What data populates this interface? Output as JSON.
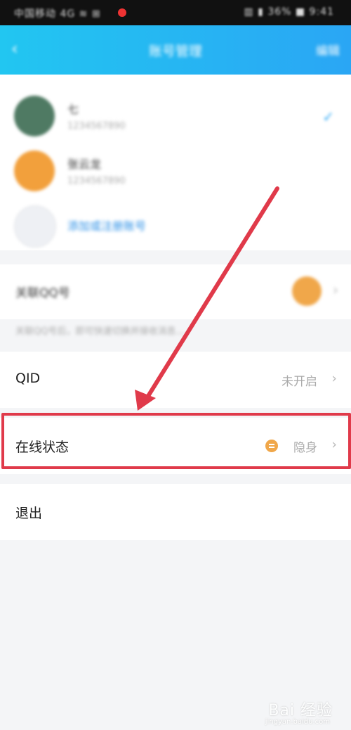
{
  "status_bar": {
    "left_text": "中国移动 4G ≋ ⊞",
    "right_text": "▥ ▮ 36% ■ 9:41"
  },
  "header": {
    "back_icon": "back-arrow-icon",
    "title": "账号管理",
    "action": "编辑"
  },
  "accounts": {
    "items": [
      {
        "name": "七",
        "sub": "1234567890",
        "avatar_color": "#4f7a63",
        "selected": true
      },
      {
        "name": "张云龙",
        "sub": "1234567890",
        "avatar_color": "#f2a03c",
        "selected": false
      }
    ],
    "add_label": "添加或注册账号",
    "checkmark": "✓"
  },
  "related": {
    "label": "关联QQ号",
    "note": "关联QQ号后，即可快速切换并接收消息..."
  },
  "menu": {
    "qid": {
      "label": "QID",
      "value": "未开启"
    },
    "online_status": {
      "label": "在线状态",
      "value": "隐身"
    },
    "logout": {
      "label": "退出"
    },
    "chevron": "›"
  },
  "annotation": {
    "highlight_color": "#e03a4a"
  },
  "watermark": {
    "text": "Bai 经验",
    "sub": "jingyan.baidu.com"
  }
}
